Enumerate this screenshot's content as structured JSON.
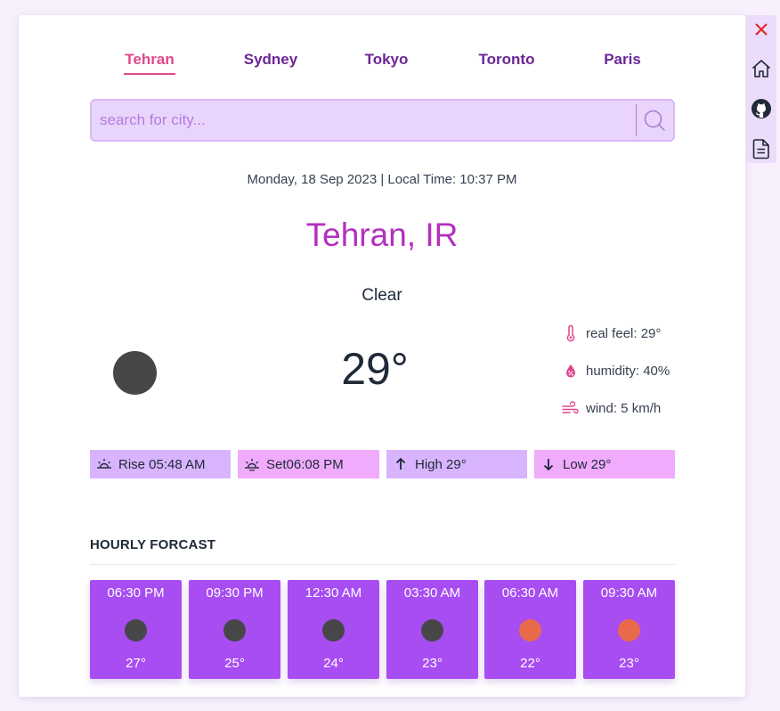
{
  "tabs": [
    {
      "label": "Tehran",
      "active": true
    },
    {
      "label": "Sydney",
      "active": false
    },
    {
      "label": "Tokyo",
      "active": false
    },
    {
      "label": "Toronto",
      "active": false
    },
    {
      "label": "Paris",
      "active": false
    }
  ],
  "search": {
    "placeholder": "search for city...",
    "value": ""
  },
  "datetime": "Monday, 18 Sep 2023 | Local Time: 10:37 PM",
  "city": "Tehran, IR",
  "condition": "Clear",
  "temperature": "29°",
  "details": {
    "real_feel": "real feel: 29°",
    "humidity": "humidity: 40%",
    "wind": "wind: 5 km/h"
  },
  "pills": {
    "rise": "Rise 05:48 AM",
    "set": "Set06:08 PM",
    "high": "High 29°",
    "low": "Low 29°"
  },
  "hourly": {
    "title": "HOURLY FORCAST",
    "items": [
      {
        "time": "06:30 PM",
        "temp": "27°",
        "icon": "moon"
      },
      {
        "time": "09:30 PM",
        "temp": "25°",
        "icon": "moon"
      },
      {
        "time": "12:30 AM",
        "temp": "24°",
        "icon": "moon"
      },
      {
        "time": "03:30 AM",
        "temp": "23°",
        "icon": "moon"
      },
      {
        "time": "06:30 AM",
        "temp": "22°",
        "icon": "sun"
      },
      {
        "time": "09:30 AM",
        "temp": "23°",
        "icon": "sun"
      }
    ]
  },
  "sidebar": {
    "icons": [
      "close-icon",
      "home-icon",
      "github-icon",
      "document-icon"
    ]
  },
  "colors": {
    "accent": "#e0488f",
    "tab": "#6b2596",
    "city": "#b32fbf",
    "hourly_card": "#a84df2",
    "moon": "#47474a",
    "sun": "#e86a4a",
    "pill_rise": "#d8b4fe",
    "pill_set": "#f0abfc",
    "pill_high": "#d8b4fe",
    "pill_low": "#f0abfc"
  }
}
